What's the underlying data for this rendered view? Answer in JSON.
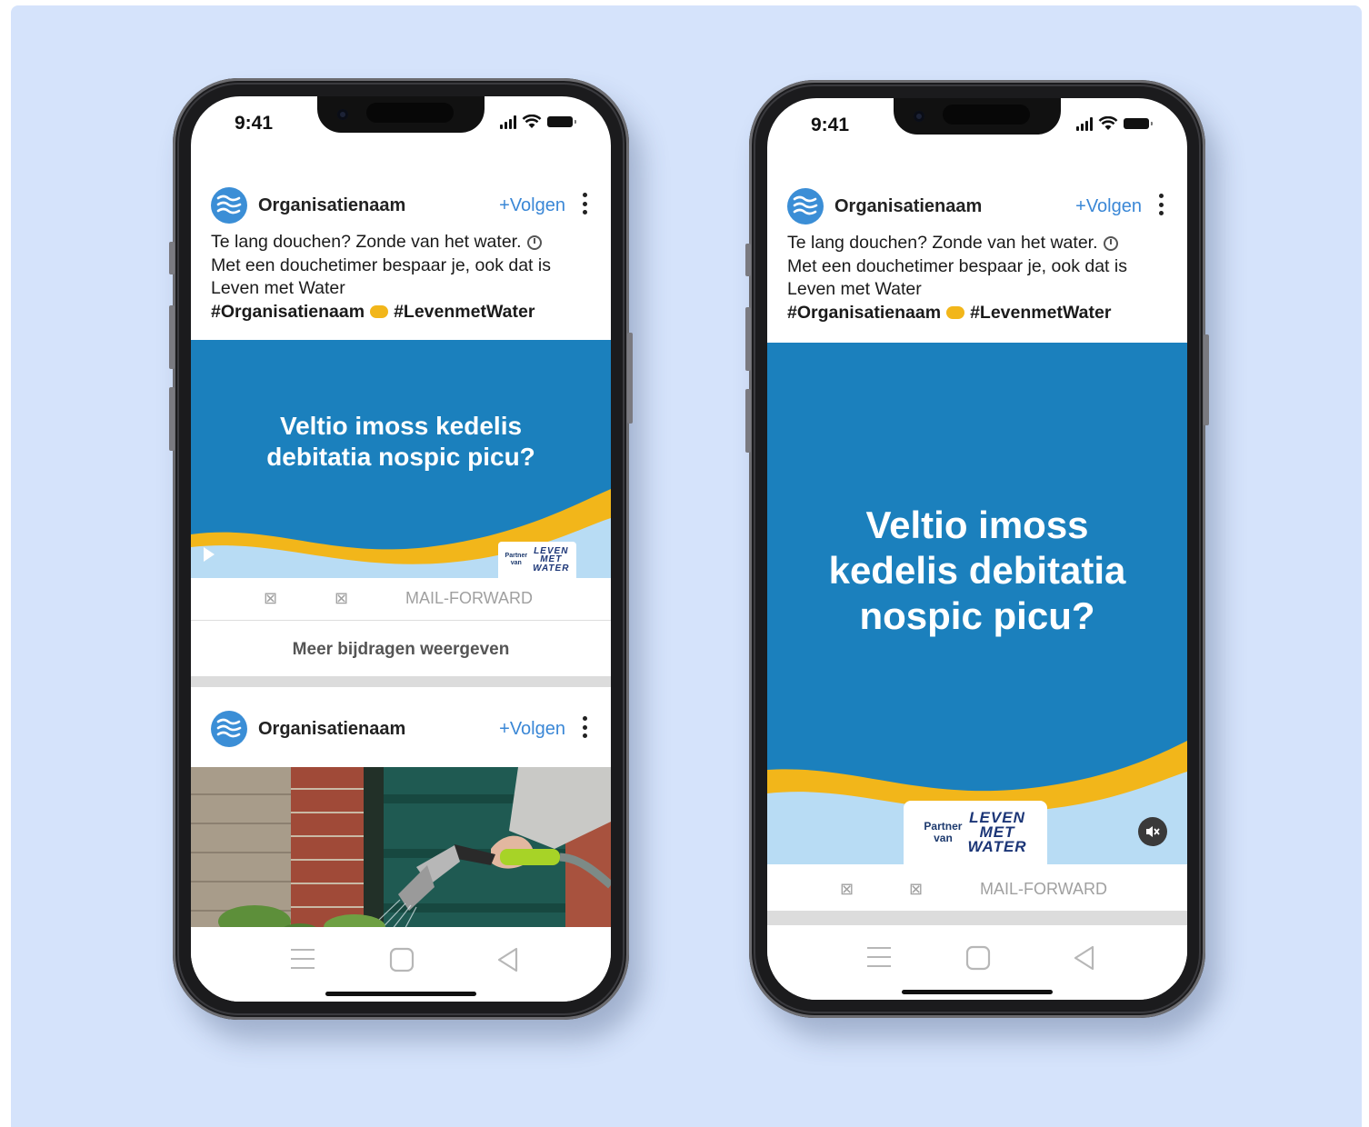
{
  "status": {
    "time": "9:41"
  },
  "post": {
    "org_name": "Organisatienaam",
    "follow_label": "+Volgen",
    "caption_line1": "Te lang douchen? Zonde van het water.",
    "caption_line2": "Met een douchetimer bespaar je, ook dat is",
    "caption_line3": "Leven met Water",
    "tag1": "#Organisatienaam",
    "tag2": "#LevenmetWater",
    "headline_line1": "Veltio imoss kedelis",
    "headline_line2": "debitatia nospic picu?",
    "headline_tall_line1": "Veltio imoss",
    "headline_tall_line2": "kedelis debitatia",
    "headline_tall_line3": "nospic picu?",
    "partner_label_1": "Partner",
    "partner_label_2": "van",
    "partner_brand_1": "LEVEN",
    "partner_brand_2": "MET",
    "partner_brand_3": "WATER",
    "actions": {
      "like": "⊠",
      "comment": "⊠",
      "share": "MAIL-FORWARD"
    },
    "more_posts": "Meer bijdragen weergeven"
  },
  "colors": {
    "background": "#d5e3fb",
    "media_blue": "#1b80bd",
    "wave_yellow": "#f2b61a",
    "wave_light_blue": "#b8dcf4",
    "accent_link": "#3a87d6"
  },
  "icons": [
    "signal-icon",
    "wifi-icon",
    "battery-icon",
    "more-vertical-icon",
    "timer-icon",
    "yellow-heart-icon",
    "play-icon",
    "mute-icon",
    "menu-nav-icon",
    "home-nav-icon",
    "back-nav-icon"
  ]
}
